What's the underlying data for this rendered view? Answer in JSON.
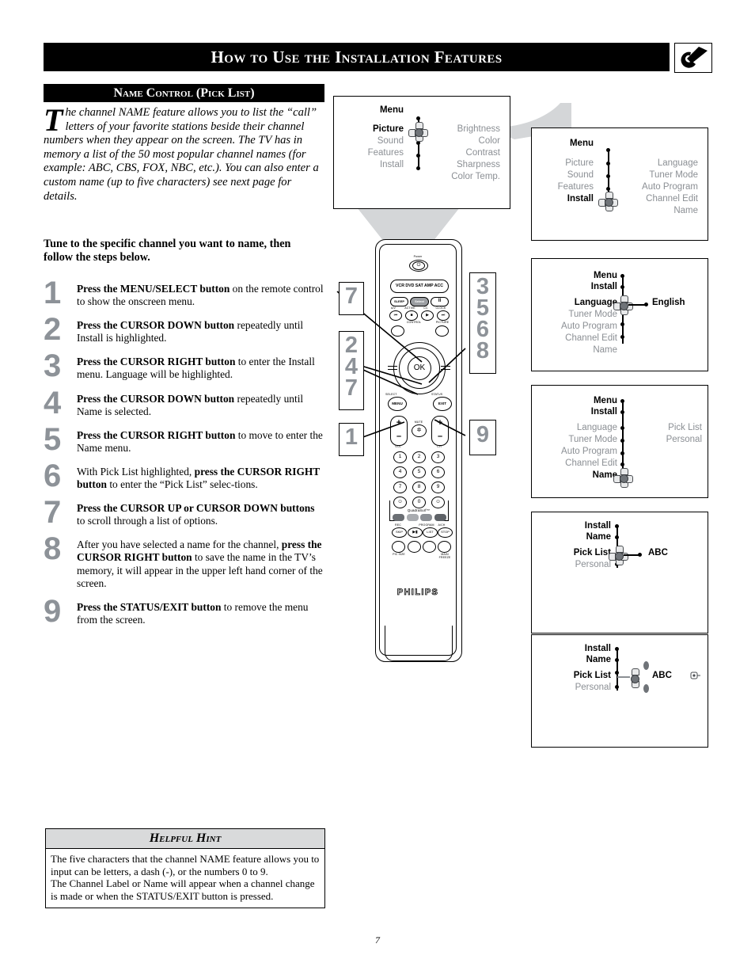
{
  "header": {
    "title": "How to Use the Installation Features",
    "icon": "tv-setup-tool-icon"
  },
  "section": {
    "title": "Name Control (Pick List)"
  },
  "intro": {
    "dropcap": "T",
    "text": "he channel NAME feature allows you to list the “call” letters of your favorite stations beside their channel numbers when they appear on the screen.  The TV has in memory a list of the 50 most popular channel names (for example: ABC, CBS, FOX, NBC, etc.).  You can also enter a custom name (up to five characters) see next page for details.",
    "note": "Tune to the specific channel you want to name, then follow the steps below."
  },
  "steps": [
    {
      "num": "1",
      "html": "<b>Press the MENU/SELECT button</b> on the remote control to show the onscreen menu."
    },
    {
      "num": "2",
      "html": "<b>Press the CURSOR DOWN button</b> repeatedly until Install is highlighted."
    },
    {
      "num": "3",
      "html": "<b>Press the CURSOR RIGHT button</b> to enter the Install menu. Language will be highlighted."
    },
    {
      "num": "4",
      "html": "<b>Press the CURSOR DOWN button</b> repeatedly until Name is selected."
    },
    {
      "num": "5",
      "html": "<b>Press the CURSOR RIGHT button</b> to move to enter the Name menu."
    },
    {
      "num": "6",
      "html": "With Pick List highlighted, <b>press the CURSOR RIGHT button</b> to enter the “Pick List” selec-tions."
    },
    {
      "num": "7",
      "html": "<b>Press the CURSOR UP or CURSOR DOWN buttons</b> to scroll through a list of options."
    },
    {
      "num": "8",
      "html": "After you have selected a name for the channel, <b>press the CURSOR RIGHT button</b> to save the name in the TV’s memory, it will appear in the upper left hand corner of the screen."
    },
    {
      "num": "9",
      "html": "<b>Press the STATUS/EXIT button</b> to remove the menu from the screen."
    }
  ],
  "screens": [
    {
      "id": "screen-main-menu",
      "heading": "Menu",
      "left_items": [
        "Picture",
        "Sound",
        "Features",
        "Install"
      ],
      "highlighted_left": "Picture",
      "right_items": [
        "Brightness",
        "Color",
        "Contrast",
        "Sharpness",
        "Color Temp."
      ],
      "value": ""
    },
    {
      "id": "screen-install-selected",
      "heading": "Menu",
      "left_items": [
        "Picture",
        "Sound",
        "Features",
        "Install"
      ],
      "highlighted_left": "Install",
      "right_items": [
        "Language",
        "Tuner Mode",
        "Auto Program",
        "Channel Edit",
        "Name"
      ],
      "value": ""
    },
    {
      "id": "screen-language",
      "headings": [
        "Menu",
        "Install"
      ],
      "left_items": [
        "Language",
        "Tuner Mode",
        "Auto Program",
        "Channel Edit",
        "Name"
      ],
      "highlighted_left": "Language",
      "value": "English"
    },
    {
      "id": "screen-name-selected",
      "headings": [
        "Menu",
        "Install"
      ],
      "left_items": [
        "Language",
        "Tuner Mode",
        "Auto Program",
        "Channel Edit",
        "Name"
      ],
      "highlighted_left": "Name",
      "right_items": [
        "Pick List",
        "Personal"
      ]
    },
    {
      "id": "screen-pick-list",
      "headings": [
        "Install",
        "Name"
      ],
      "left_items": [
        "Pick List",
        "Personal"
      ],
      "highlighted_left": "Pick List",
      "value": "ABC"
    },
    {
      "id": "screen-pick-list-scroll",
      "headings": [
        "Install",
        "Name"
      ],
      "left_items": [
        "Pick List",
        "Personal"
      ],
      "highlighted_left": "Pick List",
      "value": "ABC"
    }
  ],
  "remote": {
    "brand": "PHILIPS",
    "power_label": "Power",
    "mode_bar": "VCR DVD SAT AMP ACC",
    "keys_row1": [
      "SLEEP",
      "Select",
      "II"
    ],
    "keys_row1_sub": [
      "A/V",
      "ACTIVE",
      "CC",
      "CLOCK"
    ],
    "transport_sub": "CONTROL",
    "picture_label": "PICTURE",
    "ok_label": "OK",
    "menu_label": "MENU",
    "menu_sub": "SELECT",
    "exit_label": "EXIT",
    "exit_sub": "STATUS",
    "vol_label": "VOL",
    "ch_label": "CH",
    "mute_label": "MUTE",
    "numbers": [
      "1",
      "2",
      "3",
      "4",
      "5",
      "6",
      "7",
      "8",
      "9",
      "0"
    ],
    "quadrasurf": "QuadraSurf™",
    "gkey_labels": [
      "REC",
      "PROGRAM",
      "A/CH"
    ],
    "fn_keys": [
      "SKIP",
      "LIST",
      "STOP"
    ],
    "pic_label": "PIC SIZE",
    "freeze_label": "MAIN FREEZE"
  },
  "callouts": [
    {
      "id": "callout-left-top",
      "numbers": [
        "7"
      ]
    },
    {
      "id": "callout-left-mid",
      "numbers": [
        "2",
        "4",
        "7"
      ]
    },
    {
      "id": "callout-left-bottom",
      "numbers": [
        "1"
      ]
    },
    {
      "id": "callout-right-top",
      "numbers": [
        "3",
        "5",
        "6",
        "8"
      ]
    },
    {
      "id": "callout-right-bottom",
      "numbers": [
        "9"
      ]
    }
  ],
  "hint": {
    "title": "Helpful Hint",
    "body": "The five characters that the channel NAME feature allows you to input can be letters, a dash (-), or the numbers 0 to 9.\nThe Channel Label or Name will appear when a channel change is made or when the STATUS/EXIT button is pressed."
  },
  "page_number": "7"
}
